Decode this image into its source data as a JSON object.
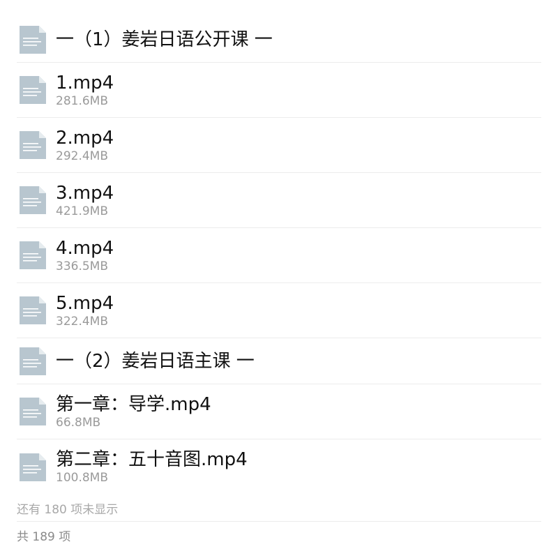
{
  "items": [
    {
      "kind": "header",
      "title": "一（1）姜岩日语公开课 一",
      "icon": "document-icon"
    },
    {
      "kind": "file",
      "title": "1.mp4",
      "size": "281.6MB",
      "icon": "document-icon"
    },
    {
      "kind": "file",
      "title": "2.mp4",
      "size": "292.4MB",
      "icon": "document-icon"
    },
    {
      "kind": "file",
      "title": "3.mp4",
      "size": "421.9MB",
      "icon": "document-icon"
    },
    {
      "kind": "file",
      "title": "4.mp4",
      "size": "336.5MB",
      "icon": "document-icon"
    },
    {
      "kind": "file",
      "title": "5.mp4",
      "size": "322.4MB",
      "icon": "document-icon"
    },
    {
      "kind": "header",
      "title": "一（2）姜岩日语主课 一",
      "icon": "document-icon"
    },
    {
      "kind": "file",
      "title": "第一章：导学.mp4",
      "size": "66.8MB",
      "icon": "document-icon"
    },
    {
      "kind": "file",
      "title": "第二章：五十音图.mp4",
      "size": "100.8MB",
      "icon": "document-icon"
    }
  ],
  "footer": {
    "more_text": "还有 180 项未显示",
    "total_text": "共 189 项"
  },
  "colors": {
    "icon_fill": "#b8c6cf",
    "icon_lines": "#ffffff",
    "divider": "#ececec",
    "size_text": "#9a9a9a"
  }
}
